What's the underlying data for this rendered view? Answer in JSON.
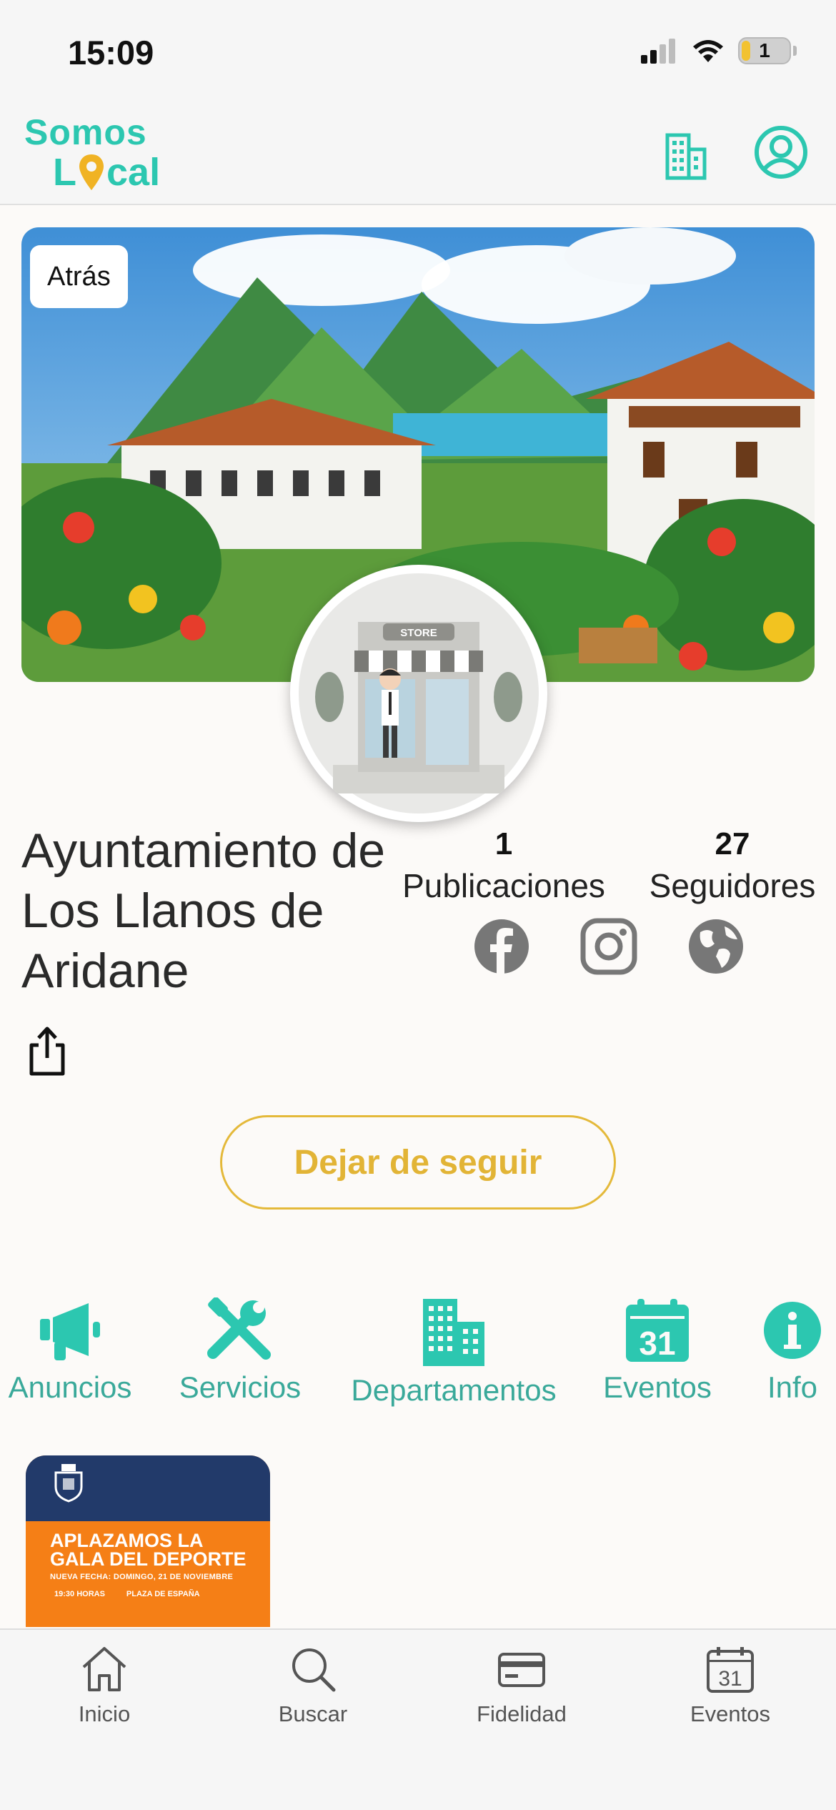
{
  "status_bar": {
    "time": "15:09",
    "battery": "1"
  },
  "header": {
    "logo_line1": "Somos",
    "logo_line2_left": "L",
    "logo_line2_right": "cal",
    "building_icon": "building-icon",
    "user_icon": "user-circle-icon"
  },
  "hero": {
    "back_label": "Atrás",
    "avatar_sign": "STORE"
  },
  "profile": {
    "name": "Ayuntamiento de Los Llanos de Aridane",
    "publications_count": "1",
    "publications_label": "Publicaciones",
    "followers_count": "27",
    "followers_label": "Seguidores",
    "unfollow_label": "Dejar de seguir"
  },
  "categories": [
    {
      "label": "Anuncios",
      "icon": "megaphone-icon"
    },
    {
      "label": "Servicios",
      "icon": "tools-icon"
    },
    {
      "label": "Departamentos",
      "icon": "building-icon"
    },
    {
      "label": "Eventos",
      "icon": "calendar-icon",
      "day": "31"
    },
    {
      "label": "Info",
      "icon": "info-icon"
    }
  ],
  "post": {
    "title_line1": "APLAZAMOS LA",
    "title_line2": "GALA DEL DEPORTE",
    "subtitle": "NUEVA FECHA: DOMINGO, 21 DE NOVIEMBRE",
    "time": "19:30 HORAS",
    "place": "PLAZA DE ESPAÑA"
  },
  "tab_bar": [
    {
      "label": "Inicio",
      "icon": "home-icon"
    },
    {
      "label": "Buscar",
      "icon": "search-icon"
    },
    {
      "label": "Fidelidad",
      "icon": "card-icon"
    },
    {
      "label": "Eventos",
      "icon": "calendar-icon",
      "day": "31"
    }
  ],
  "colors": {
    "accent": "#2cc7b0",
    "gold": "#e2b436",
    "category_text": "#3aa99a"
  }
}
